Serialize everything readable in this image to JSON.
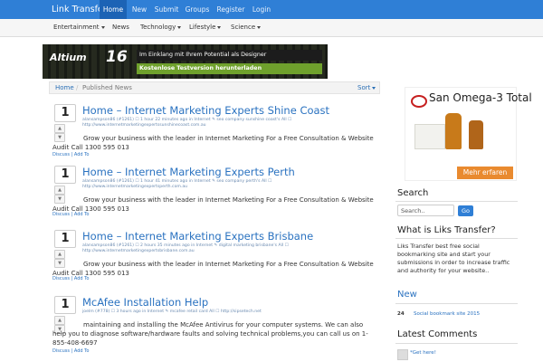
{
  "nav": {
    "brand": "Link Transfer",
    "items": [
      "Home",
      "New",
      "Submit",
      "Groups",
      "Register",
      "Login"
    ]
  },
  "subnav": {
    "items": [
      "Entertainment",
      "News",
      "Technology",
      "Lifestyle",
      "Science"
    ]
  },
  "banner_ad": {
    "logo": "Altium",
    "logo_number": "16",
    "tagline": "Im Einklang mit Ihrem Potential als Designer",
    "cta": "Kostenlose Testversion herunterladen"
  },
  "breadcrumb": {
    "home": "Home",
    "separator": "/",
    "current": "Published News",
    "sort": "Sort"
  },
  "articles": [
    {
      "votes": "1",
      "title": "Home – Internet Marketing Experts Shine Coast",
      "meta": "alansampson86 (#1261) ☐ 1 hour 22 minutes ago in Internet ✎ seo company sunshine coast's All ☐ http://www.internetmarketingexpertssunshinecoast.com.au",
      "description": "Grow your business with the leader in Internet Marketing For a Free Consultation & Website Audit Call 1300 595 013",
      "discuss": "Discuss",
      "add_to": "Add To"
    },
    {
      "votes": "1",
      "title": "Home – Internet Marketing Experts Perth",
      "meta": "alansampson86 (#1261) ☐ 1 hour 41 minutes ago in Internet ✎ seo company perth's All ☐ http://www.internetmarketingexpertsperth.com.au",
      "description": "Grow your business with the leader in Internet Marketing For a Free Consultation & Website Audit Call 1300 595 013",
      "discuss": "Discuss",
      "add_to": "Add To"
    },
    {
      "votes": "1",
      "title": "Home – Internet Marketing Experts Brisbane",
      "meta": "alansampson86 (#1261) ☐ 2 hours 35 minutes ago in Internet ✎ digital marketing brisbane's All ☐ http://www.internetmarketingexpertsbrisbane.com.au",
      "description": "Grow your business with the leader in Internet Marketing For a Free Consultation & Website Audit Call 1300 595 013",
      "discuss": "Discuss",
      "add_to": "Add To"
    },
    {
      "votes": "1",
      "title": "McAfee Installation Help",
      "meta": "joelm (#778) ☐ 3 hours ago in Internet ✎ mcafee retail card All ☐ http://sipsetech.net",
      "description": "maintaining and installing the McAfee Antivirus for your computer systems. We can also help you to diagnose software/hardware faults and solving technical problems,you can call us on 1-855-408-6697",
      "discuss": "Discuss",
      "add_to": "Add To"
    }
  ],
  "side_ad": {
    "headline": "San Omega-3 Total",
    "button": "Mehr erfaren"
  },
  "sidebar": {
    "search_title": "Search",
    "search_placeholder": "Search..",
    "go": "Go",
    "about_title": "What is Liks Transfer?",
    "about_text": "Liks Transfer best free social bookmarking site and start your submissions in order to increase traffic and authority for your website..",
    "new_title": "New",
    "new_items": [
      {
        "count": "24",
        "label": "Social bookmark site 2015"
      }
    ],
    "comments_title": "Latest Comments",
    "comment_text": "*Get here!"
  },
  "colors": {
    "navbar": "#2f7fd6",
    "navbar_active": "#1c63b5",
    "link": "#2a72c0"
  }
}
